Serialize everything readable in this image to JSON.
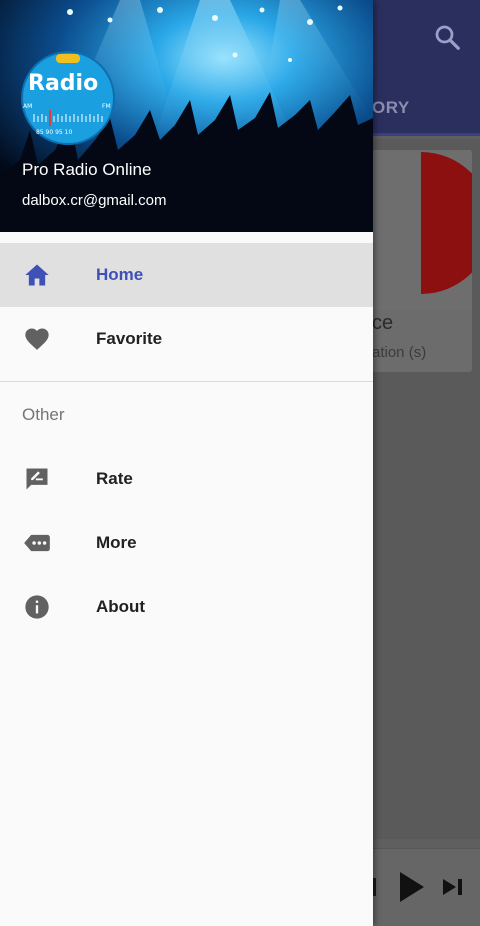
{
  "background": {
    "tab_label": "ORY",
    "card": {
      "title": "ce",
      "subtitle": "ation (s)"
    }
  },
  "drawer": {
    "header": {
      "logo_text": "Radio",
      "logo_badge": "FM",
      "logo_band_left": "AM",
      "logo_band_right": "FM",
      "logo_scale": "85 90 95 10",
      "app_name": "Pro Radio Online",
      "email": "dalbox.cr@gmail.com"
    },
    "menu": [
      {
        "label": "Home",
        "icon": "home-icon",
        "active": true
      },
      {
        "label": "Favorite",
        "icon": "heart-icon",
        "active": false
      }
    ],
    "section_label": "Other",
    "other_menu": [
      {
        "label": "Rate",
        "icon": "rate-review-icon"
      },
      {
        "label": "More",
        "icon": "more-tag-icon"
      },
      {
        "label": "About",
        "icon": "info-icon"
      }
    ]
  },
  "colors": {
    "accent": "#3f51b5",
    "toolbar": "#2b2f5e",
    "scrim": "#5f5f5f",
    "icon_gray": "#616161"
  }
}
